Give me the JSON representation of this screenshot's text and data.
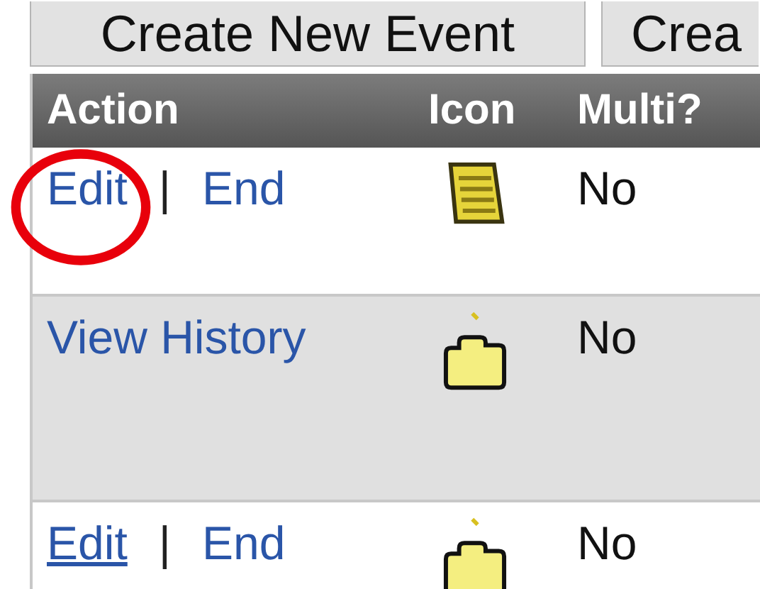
{
  "buttons": [
    "Create New Event",
    "Crea"
  ],
  "table": {
    "columns": [
      "Action",
      "Icon",
      "Multi?"
    ],
    "rows": [
      {
        "actions": [
          {
            "label": "Edit",
            "underlined": false,
            "circled": true
          },
          {
            "label": "End",
            "underlined": false,
            "circled": false
          }
        ],
        "separator": "|",
        "icon": {
          "kind": "note"
        },
        "multi": "No",
        "shaded": false
      },
      {
        "actions": [
          {
            "label": "View History",
            "underlined": false,
            "circled": false
          }
        ],
        "icon": {
          "kind": "folder"
        },
        "multi": "No",
        "shaded": true
      },
      {
        "actions": [
          {
            "label": "Edit",
            "underlined": true,
            "circled": false
          },
          {
            "label": "End",
            "underlined": false,
            "circled": false
          }
        ],
        "separator": "|",
        "icon": {
          "kind": "folder"
        },
        "multi": "No",
        "shaded": false
      }
    ]
  }
}
